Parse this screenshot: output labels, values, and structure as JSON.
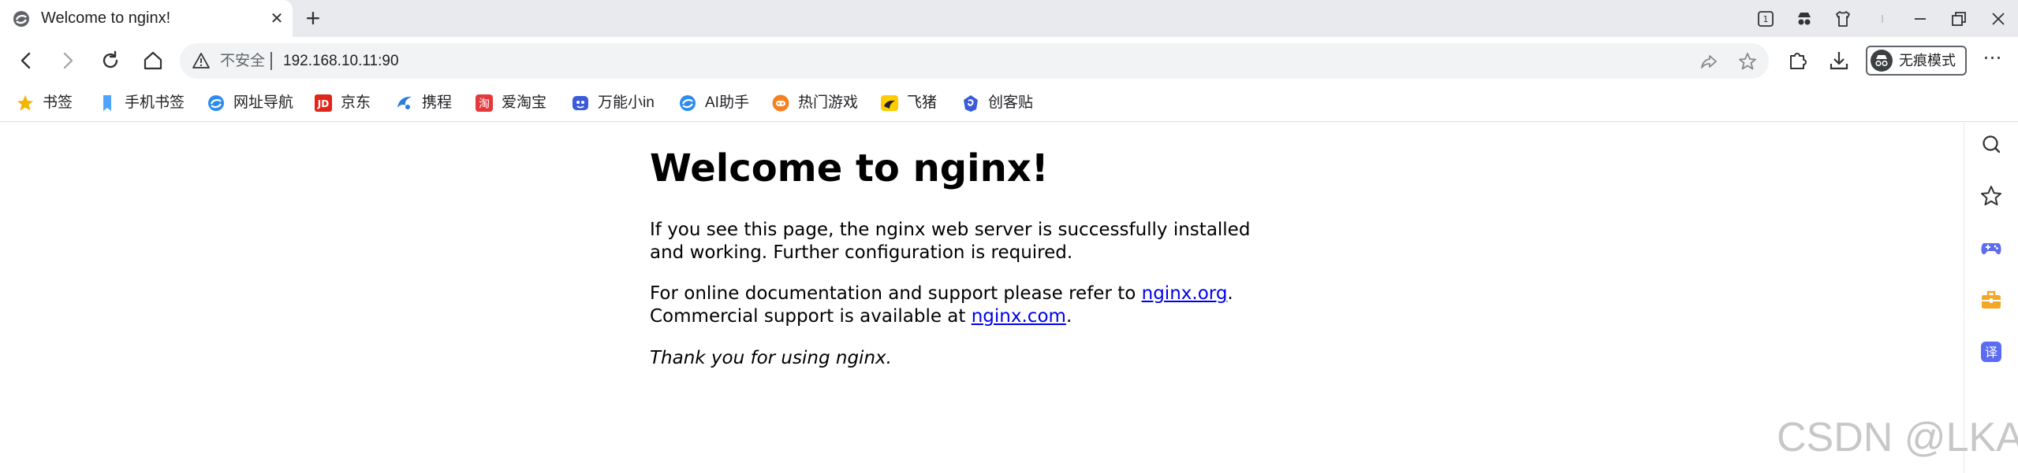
{
  "tab": {
    "title": "Welcome to nginx!",
    "close_glyph": "✕",
    "favicon": "globe-icon"
  },
  "new_tab_glyph": "+",
  "window_controls": {
    "minimize_glyph": "—",
    "restore_glyph": "❐",
    "close_glyph": "✕"
  },
  "omnibox": {
    "security_label": "不安全",
    "url": "192.168.10.11:90"
  },
  "incognito": {
    "label": "无痕模式"
  },
  "more_glyph": "⋯",
  "bookmarks": [
    {
      "label": "书签",
      "icon": "star-icon",
      "color": "#f4b400"
    },
    {
      "label": "手机书签",
      "icon": "phone-bookmark-icon",
      "color": "#4da3ff"
    },
    {
      "label": "网址导航",
      "icon": "navigation-icon",
      "color": "#2d8cf0"
    },
    {
      "label": "京东",
      "icon": "jd-icon",
      "color": "#e1251b"
    },
    {
      "label": "携程",
      "icon": "ctrip-icon",
      "color": "#2a7de1"
    },
    {
      "label": "爱淘宝",
      "icon": "taobao-icon",
      "color": "#e4393c"
    },
    {
      "label": "万能小in",
      "icon": "assistant-icon",
      "color": "#3b5bdb"
    },
    {
      "label": "AI助手",
      "icon": "ai-assistant-icon",
      "color": "#2d8cf0"
    },
    {
      "label": "热门游戏",
      "icon": "games-icon",
      "color": "#f58220"
    },
    {
      "label": "飞猪",
      "icon": "fliggy-icon",
      "color": "#ffcc00"
    },
    {
      "label": "创客贴",
      "icon": "chuangketie-icon",
      "color": "#3b5bdb"
    }
  ],
  "page": {
    "heading": "Welcome to nginx!",
    "para1": "If you see this page, the nginx web server is successfully installed and working. Further configuration is required.",
    "para2_prefix": "For online documentation and support please refer to ",
    "link1": "nginx.org",
    "para2_mid": ".",
    "para2_line2": "Commercial support is available at ",
    "link2": "nginx.com",
    "para2_end": ".",
    "thanks": "Thank you for using nginx."
  },
  "sidebar": {
    "items": [
      "search-icon",
      "favorites-star-icon",
      "gamepad-icon",
      "toolbox-icon",
      "translate-icon"
    ],
    "translate_glyph": "译"
  },
  "watermark": "CSDN @LKAI."
}
